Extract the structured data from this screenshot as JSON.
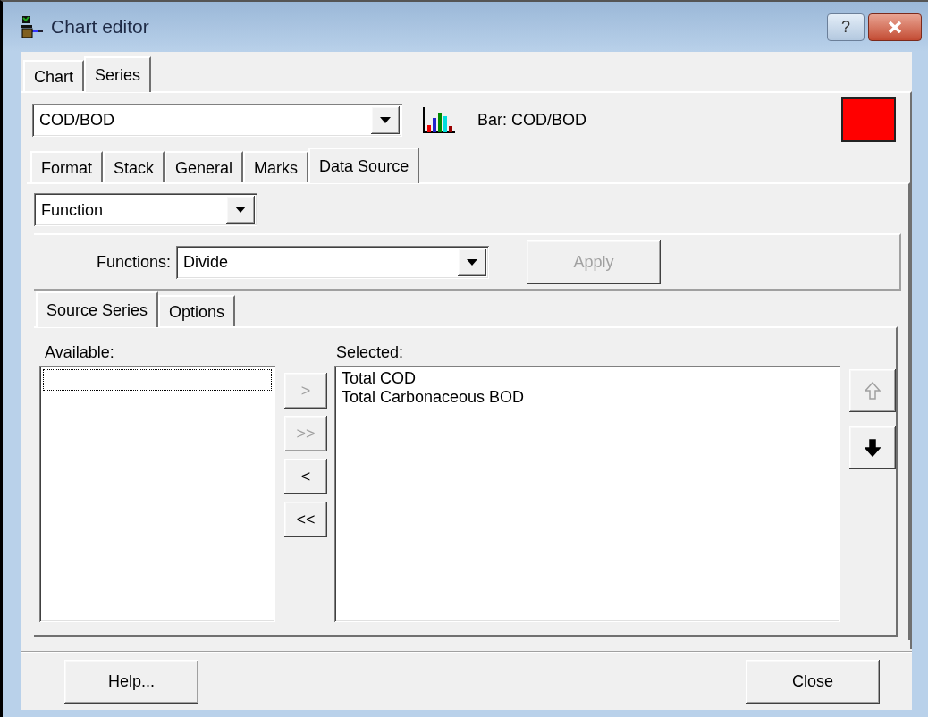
{
  "window": {
    "title": "Chart editor",
    "help_label": "?"
  },
  "tabs": [
    {
      "label": "Chart",
      "selected": false
    },
    {
      "label": "Series",
      "selected": true
    }
  ],
  "series": {
    "value": "COD/BOD",
    "description": "Bar: COD/BOD",
    "color": "#ff0000"
  },
  "series_tabs": [
    {
      "label": "Format",
      "selected": false
    },
    {
      "label": "Stack",
      "selected": false
    },
    {
      "label": "General",
      "selected": false
    },
    {
      "label": "Marks",
      "selected": false
    },
    {
      "label": "Data Source",
      "selected": true
    }
  ],
  "source_type": {
    "value": "Function"
  },
  "functions": {
    "label": "Functions:",
    "value": "Divide"
  },
  "apply_button": {
    "label": "Apply",
    "disabled": true
  },
  "source_tabs": [
    {
      "label": "Source Series",
      "selected": true
    },
    {
      "label": "Options",
      "selected": false
    }
  ],
  "available": {
    "label": "Available:"
  },
  "move_buttons": [
    {
      "label": ">",
      "disabled": true
    },
    {
      "label": ">>",
      "disabled": true
    },
    {
      "label": "<",
      "disabled": false
    },
    {
      "label": "<<",
      "disabled": false
    }
  ],
  "selected": {
    "label": "Selected:",
    "items": [
      "Total COD",
      "Total Carbonaceous BOD"
    ]
  },
  "order_buttons": [
    {
      "kind": "up",
      "disabled": true
    },
    {
      "kind": "down",
      "disabled": false
    }
  ],
  "footer_buttons": [
    {
      "label": "Help..."
    },
    {
      "label": "Close"
    }
  ]
}
